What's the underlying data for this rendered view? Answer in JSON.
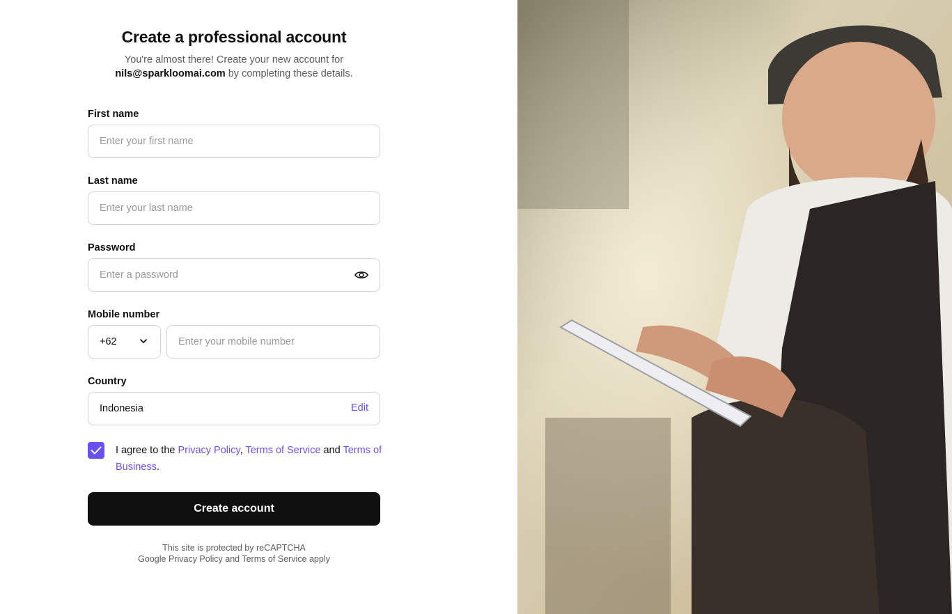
{
  "header": {
    "title": "Create a professional account",
    "subtitle_prefix": "You're almost there! Create your new account for",
    "email": "nils@sparkloomai.com",
    "subtitle_suffix": "by completing these details."
  },
  "form": {
    "first_name": {
      "label": "First name",
      "placeholder": "Enter your first name",
      "value": ""
    },
    "last_name": {
      "label": "Last name",
      "placeholder": "Enter your last name",
      "value": ""
    },
    "password": {
      "label": "Password",
      "placeholder": "Enter a password",
      "value": "",
      "toggle_icon": "eye-icon"
    },
    "mobile": {
      "label": "Mobile number",
      "country_code": "+62",
      "placeholder": "Enter your mobile number",
      "value": ""
    },
    "country": {
      "label": "Country",
      "value": "Indonesia",
      "edit_label": "Edit"
    },
    "agreement": {
      "checked": true,
      "prefix": "I agree to the",
      "privacy_link": "Privacy Policy",
      "comma": ",",
      "terms_link": "Terms of Service",
      "and": "and",
      "business_link": "Terms of Business",
      "period": "."
    },
    "submit_label": "Create account"
  },
  "recaptcha": {
    "line1": "This site is protected by reCAPTCHA",
    "google": "Google",
    "privacy": "Privacy Policy",
    "and": "and",
    "terms": "Terms of Service",
    "apply": "apply"
  },
  "colors": {
    "accent": "#6950f3",
    "button": "#101010",
    "border": "#d3d3d3",
    "placeholder": "#9a9a9a"
  },
  "hero_image": {
    "description_icon": "photo-man-with-tablet"
  }
}
